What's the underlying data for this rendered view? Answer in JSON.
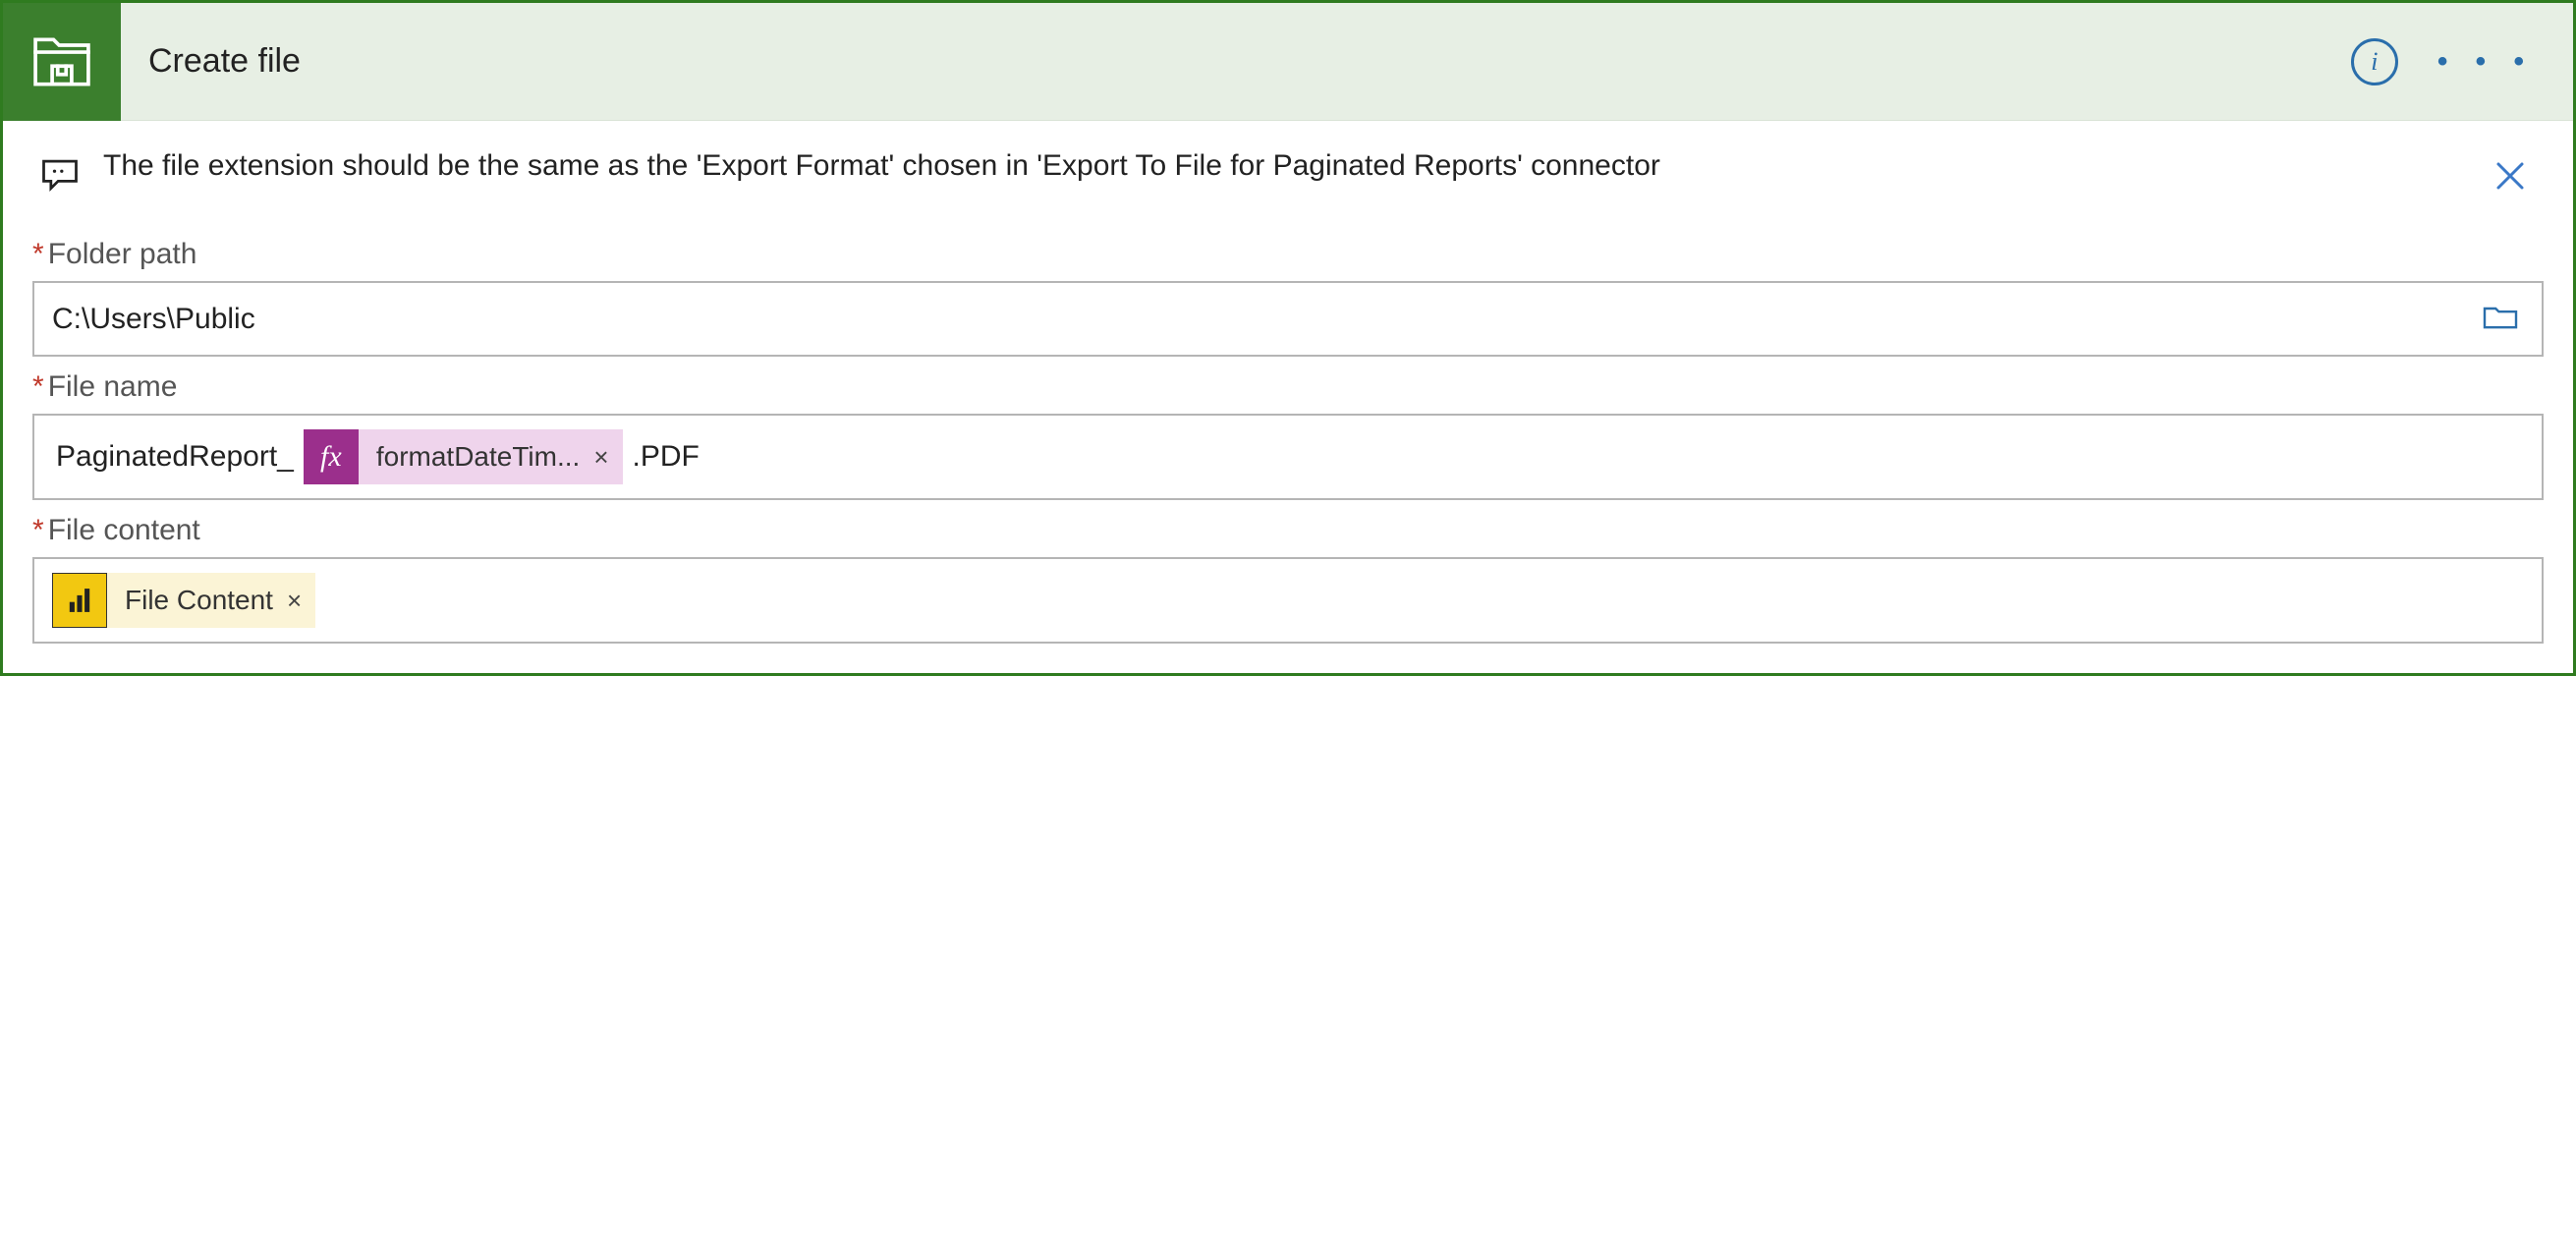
{
  "header": {
    "title": "Create file",
    "info_tooltip": "i",
    "more_menu": "•  •  •",
    "icon_name": "folder-save-icon"
  },
  "note": {
    "text": "The file extension should be the same as the 'Export Format' chosen in 'Export To File for Paginated Reports' connector",
    "comment_icon": "comment-icon",
    "close_icon": "close-icon"
  },
  "fields": {
    "folder_path": {
      "label": "Folder path",
      "required_mark": "*",
      "value": "C:\\Users\\Public",
      "picker_icon": "folder-open-icon"
    },
    "file_name": {
      "label": "File name",
      "required_mark": "*",
      "prefix_text": "PaginatedReport_",
      "expression_token": {
        "badge": "fx",
        "label": "formatDateTim...",
        "remove": "×"
      },
      "suffix_text": ".PDF"
    },
    "file_content": {
      "label": "File content",
      "required_mark": "*",
      "powerbi_token": {
        "icon": "powerbi-icon",
        "label": "File Content",
        "remove": "×"
      }
    }
  }
}
